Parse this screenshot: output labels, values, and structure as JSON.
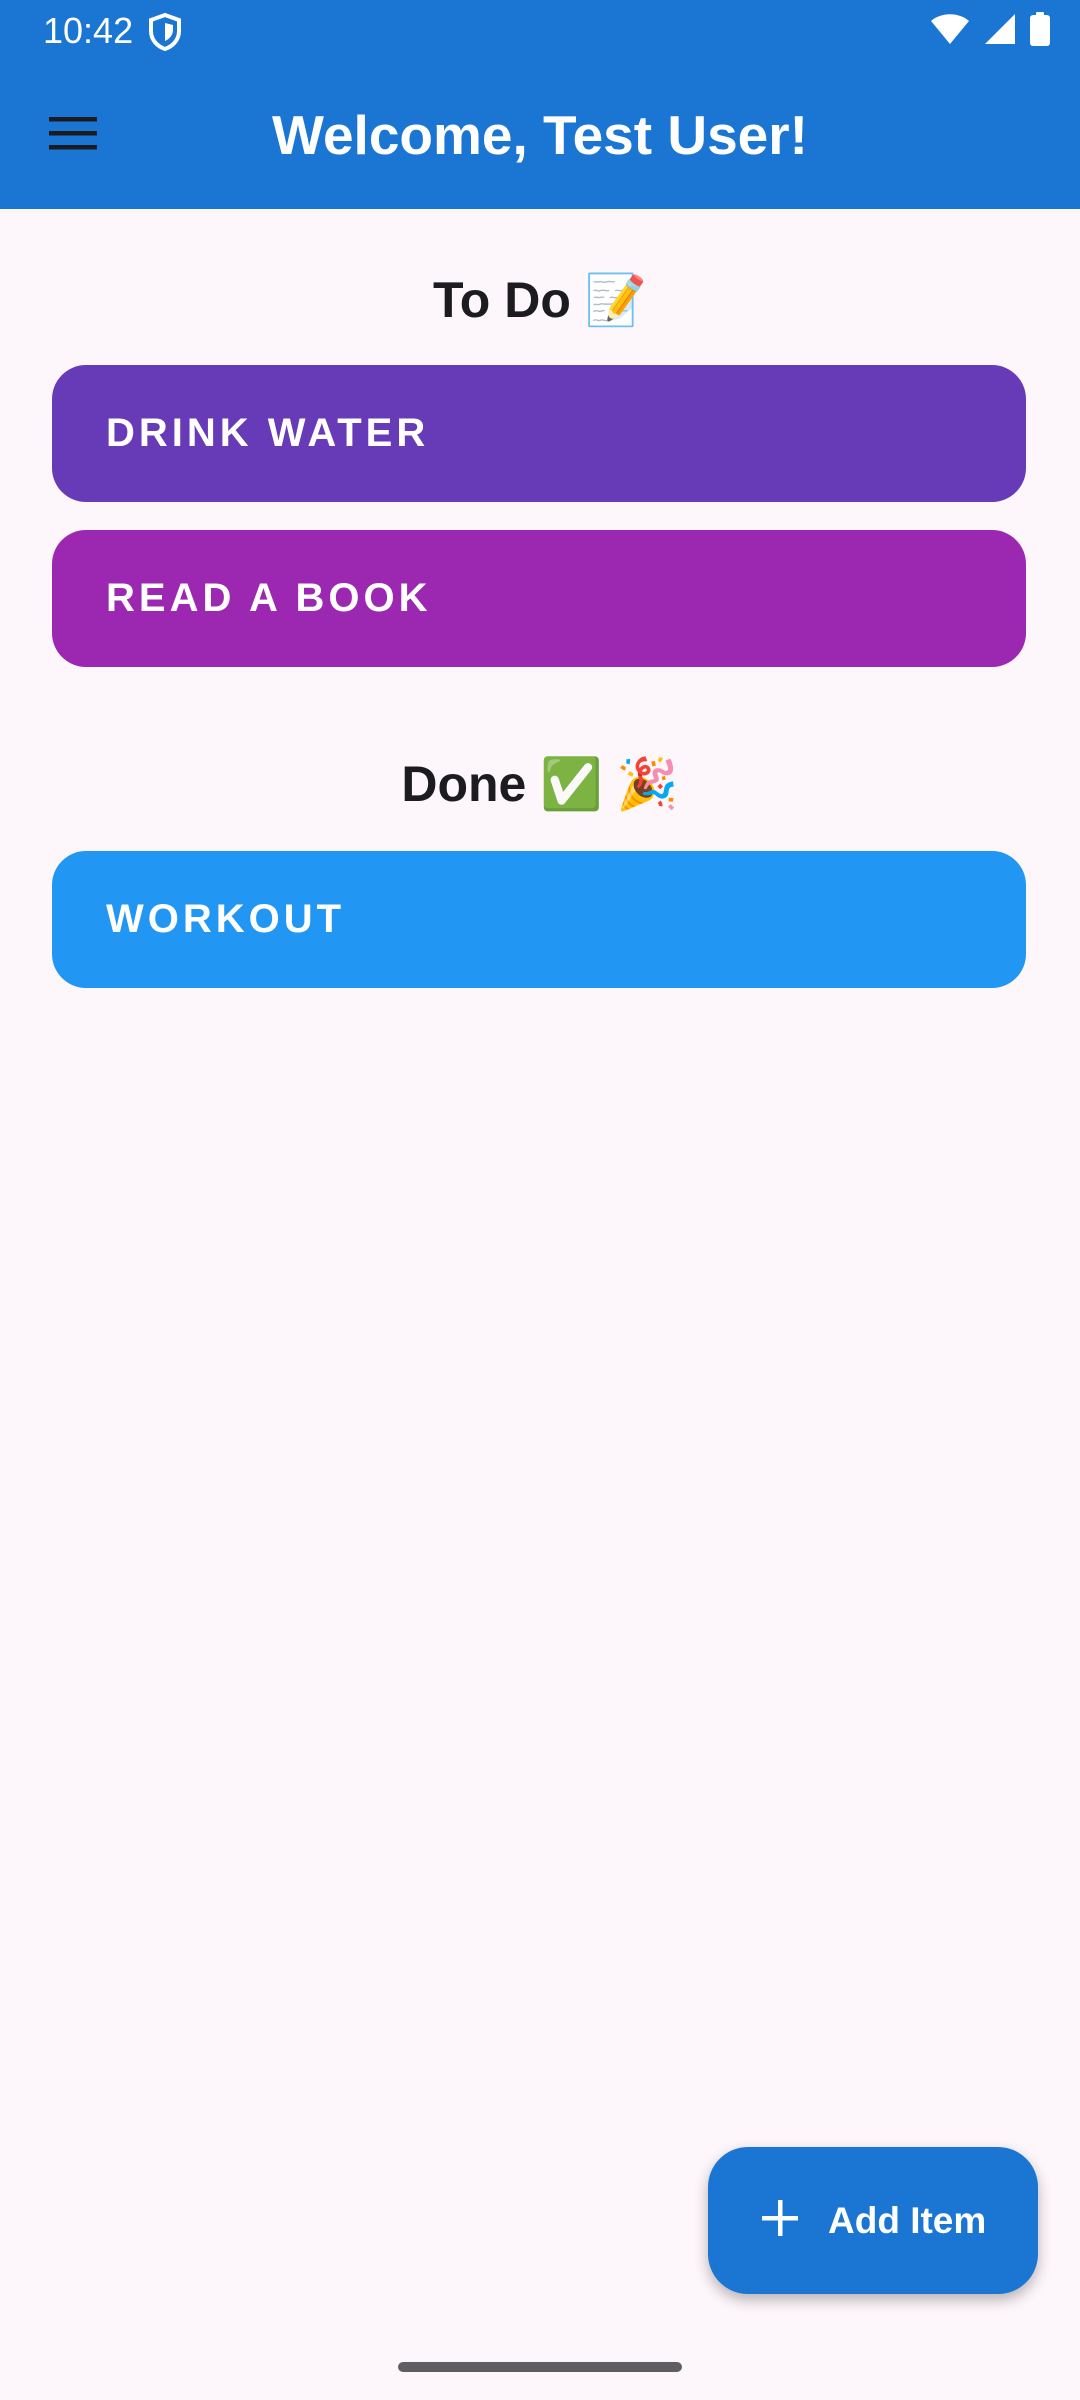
{
  "status_bar": {
    "time": "10:42",
    "icons": [
      "shield-icon",
      "wifi-icon",
      "signal-icon",
      "battery-icon"
    ]
  },
  "app_bar": {
    "title": "Welcome, Test User!",
    "menu_icon": "hamburger-menu-icon",
    "color": "#1a76d2"
  },
  "todo": {
    "title": "To Do 📝",
    "items": [
      {
        "label": "DRINK WATER",
        "color": "#673ab7"
      },
      {
        "label": "READ A BOOK",
        "color": "#9c27b0"
      }
    ]
  },
  "done": {
    "title": "Done ✅ 🎉",
    "items": [
      {
        "label": "WORKOUT",
        "color": "#2196f3"
      }
    ]
  },
  "fab": {
    "label": "Add Item",
    "icon": "plus-icon"
  }
}
